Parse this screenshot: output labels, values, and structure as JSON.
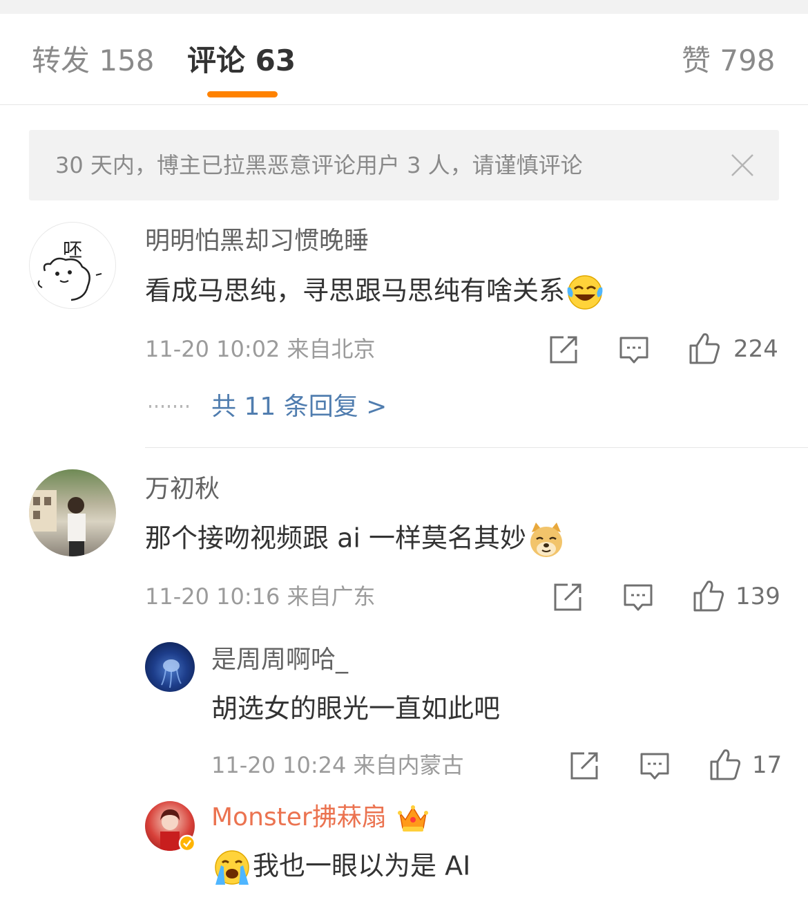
{
  "tabs": {
    "repost_label": "转发 158",
    "comment_label": "评论 63",
    "like_label": "赞 798"
  },
  "notice": {
    "text": "30 天内，博主已拉黑恶意评论用户 3 人，请谨慎评论"
  },
  "comments": [
    {
      "username": "明明怕黑却习惯晚睡",
      "text": "看成马思纯，寻思跟马思纯有啥关系",
      "emoji": "laughing-tears-emoji",
      "time_location": "11-20 10:02  来自北京",
      "likes": "224",
      "replies_label": "共 11 条回复 >",
      "avatar_text": "呸"
    },
    {
      "username": "万初秋",
      "text": "那个接吻视频跟 ai 一样莫名其妙",
      "emoji": "doge-emoji",
      "time_location": "11-20 10:16  来自广东",
      "likes": "139"
    }
  ],
  "replies": [
    {
      "username": "是周周啊哈_",
      "text": "胡选女的眼光一直如此吧",
      "time_location": "11-20 10:24  来自内蒙古",
      "likes": "17"
    },
    {
      "username": "Monster拂菻扇",
      "badge": "crown-badge-icon",
      "text": "我也一眼以为是 AI",
      "emoji": "crying-emoji"
    }
  ],
  "colors": {
    "accent": "#ff8200",
    "link": "#507daf",
    "vip_name": "#eb7350"
  }
}
